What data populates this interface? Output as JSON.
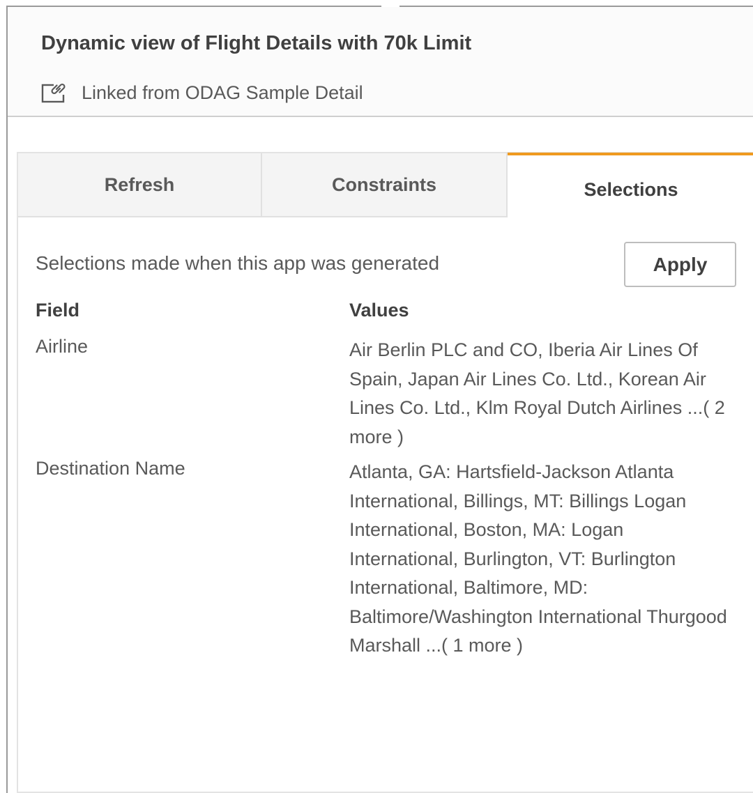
{
  "header": {
    "title": "Dynamic view of Flight Details with 70k Limit",
    "linked_text": "Linked from ODAG Sample Detail",
    "link_icon": "linked-app-icon"
  },
  "tabs": [
    {
      "label": "Refresh",
      "active": false
    },
    {
      "label": "Constraints",
      "active": false
    },
    {
      "label": "Selections",
      "active": true
    }
  ],
  "selections": {
    "subtitle": "Selections made when this app was generated",
    "apply_label": "Apply",
    "columns": {
      "field": "Field",
      "values": "Values"
    },
    "rows": [
      {
        "field": "Airline",
        "values": "Air Berlin PLC and CO, Iberia Air Lines Of Spain, Japan Air Lines Co. Ltd., Korean Air Lines Co. Ltd., Klm Royal Dutch Airlines ...( 2 more )"
      },
      {
        "field": "Destination Name",
        "values": "Atlanta, GA: Hartsfield-Jackson Atlanta International, Billings, MT: Billings Logan International, Boston, MA: Logan International, Burlington, VT: Burlington International, Baltimore, MD: Baltimore/Washington International Thurgood Marshall ...( 1 more )"
      }
    ]
  },
  "colors": {
    "accent": "#ef9a1f",
    "text": "#595959",
    "heading": "#404040"
  }
}
